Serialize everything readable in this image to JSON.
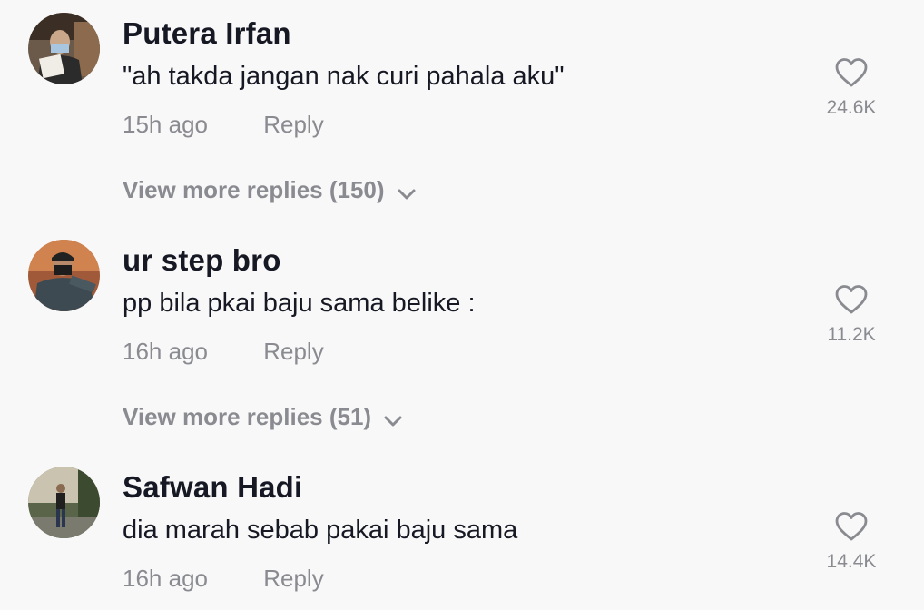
{
  "comments": [
    {
      "username": "Putera Irfan",
      "text": "\"ah takda jangan nak curi pahala aku\"",
      "time": "15h ago",
      "reply_label": "Reply",
      "likes": "24.6K",
      "more_replies": "View more replies (150)"
    },
    {
      "username": "ur step bro",
      "text": "pp bila pkai baju sama belike :",
      "time": "16h ago",
      "reply_label": "Reply",
      "likes": "11.2K",
      "more_replies": "View more replies (51)"
    },
    {
      "username": "Safwan Hadi",
      "text": "dia marah sebab pakai baju sama",
      "time": "16h ago",
      "reply_label": "Reply",
      "likes": "14.4K"
    }
  ],
  "icons": {
    "like": "heart-outline-icon",
    "expand": "chevron-down-icon"
  },
  "colors": {
    "background": "#f8f8f8",
    "primary_text": "#161823",
    "secondary_text": "#8a8b91"
  }
}
